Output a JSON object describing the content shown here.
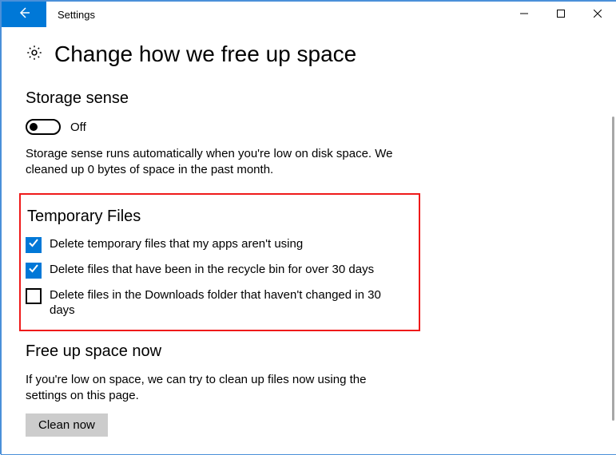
{
  "window": {
    "title": "Settings"
  },
  "page": {
    "heading": "Change how we free up space"
  },
  "storage_sense": {
    "heading": "Storage sense",
    "toggle_state": "Off",
    "description": "Storage sense runs automatically when you're low on disk space. We cleaned up 0 bytes of space in the past month."
  },
  "temp_files": {
    "heading": "Temporary Files",
    "items": [
      {
        "label": "Delete temporary files that my apps aren't using",
        "checked": true
      },
      {
        "label": "Delete files that have been in the recycle bin for over 30 days",
        "checked": true
      },
      {
        "label": "Delete files in the Downloads folder that haven't changed in 30 days",
        "checked": false
      }
    ]
  },
  "free_up": {
    "heading": "Free up space now",
    "description": "If you're low on space, we can try to clean up files now using the settings on this page.",
    "button": "Clean now"
  }
}
